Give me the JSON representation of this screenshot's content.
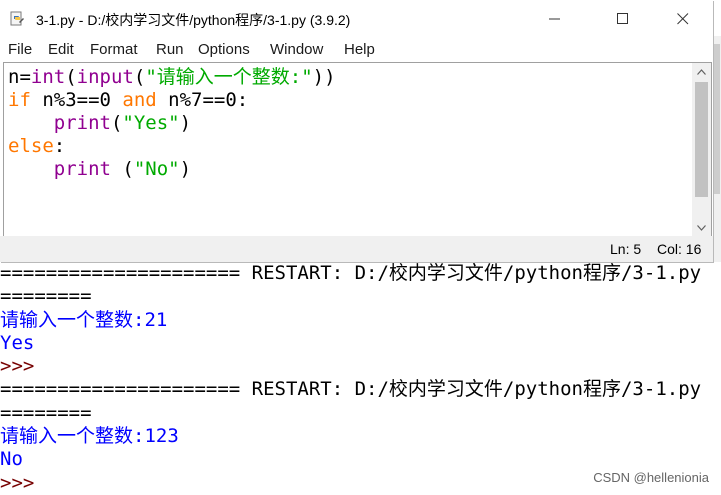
{
  "window": {
    "title": "3-1.py - D:/校内学习文件/python程序/3-1.py (3.9.2)"
  },
  "menu": [
    "File",
    "Edit",
    "Format",
    "Run",
    "Options",
    "Window",
    "Help"
  ],
  "editor": {
    "lines": [
      [
        {
          "t": "n=",
          "c": "nm"
        },
        {
          "t": "int",
          "c": "bi"
        },
        {
          "t": "(",
          "c": "nm"
        },
        {
          "t": "input",
          "c": "bi"
        },
        {
          "t": "(",
          "c": "nm"
        },
        {
          "t": "\"请输入一个整数:\"",
          "c": "str"
        },
        {
          "t": "))",
          "c": "nm"
        }
      ],
      [
        {
          "t": "if",
          "c": "kw"
        },
        {
          "t": " n%3==0 ",
          "c": "nm"
        },
        {
          "t": "and",
          "c": "kw"
        },
        {
          "t": " n%7==0:",
          "c": "nm"
        }
      ],
      [
        {
          "t": "    ",
          "c": "nm"
        },
        {
          "t": "print",
          "c": "bi"
        },
        {
          "t": "(",
          "c": "nm"
        },
        {
          "t": "\"Yes\"",
          "c": "str"
        },
        {
          "t": ")",
          "c": "nm"
        }
      ],
      [
        {
          "t": "else",
          "c": "kw"
        },
        {
          "t": ":",
          "c": "nm"
        }
      ],
      [
        {
          "t": "    ",
          "c": "nm"
        },
        {
          "t": "print",
          "c": "bi"
        },
        {
          "t": " (",
          "c": "nm"
        },
        {
          "t": "\"No\"",
          "c": "str"
        },
        {
          "t": ")",
          "c": "nm"
        }
      ]
    ]
  },
  "status": {
    "line": "Ln: 5",
    "col": "Col: 16"
  },
  "shell": {
    "lines": [
      {
        "t": "===================== RESTART: D:/校内学习文件/python程序/3-1.py",
        "c": "c-out"
      },
      {
        "t": "========",
        "c": "c-out"
      },
      {
        "parts": [
          {
            "t": "请输入一个整数:",
            "c": "c-stdout"
          },
          {
            "t": "21",
            "c": "c-stdin"
          }
        ]
      },
      {
        "t": "Yes",
        "c": "c-stdout"
      },
      {
        "t": ">>>",
        "c": "c-prompt"
      },
      {
        "t": "===================== RESTART: D:/校内学习文件/python程序/3-1.py",
        "c": "c-out"
      },
      {
        "t": "========",
        "c": "c-out"
      },
      {
        "parts": [
          {
            "t": "请输入一个整数:",
            "c": "c-stdout"
          },
          {
            "t": "123",
            "c": "c-stdin"
          }
        ]
      },
      {
        "t": "No",
        "c": "c-stdout"
      },
      {
        "t": ">>>",
        "c": "c-prompt"
      }
    ]
  },
  "watermark": "CSDN @hellenionia",
  "colors": {
    "keyword": "#ff7700",
    "builtin": "#900090",
    "string": "#00aa00",
    "stdout": "#0000ff",
    "prompt": "#770000"
  }
}
